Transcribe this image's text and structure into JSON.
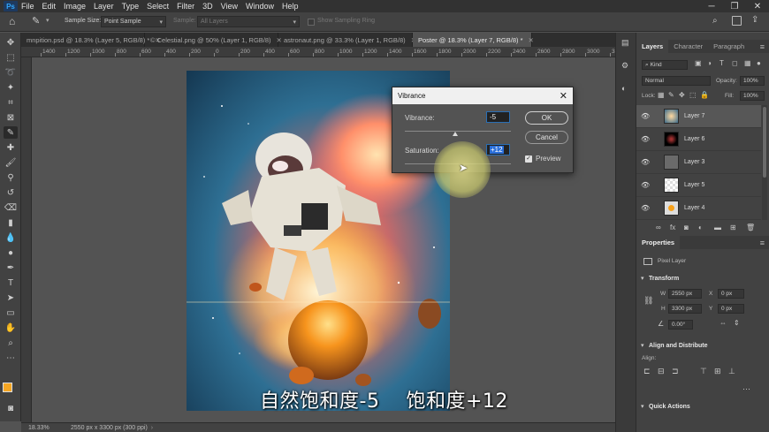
{
  "menubar": {
    "logo": "Ps",
    "items": [
      "File",
      "Edit",
      "Image",
      "Layer",
      "Type",
      "Select",
      "Filter",
      "3D",
      "View",
      "Window",
      "Help"
    ]
  },
  "options": {
    "sample_size_label": "Sample Size:",
    "sample_size_value": "Point Sample",
    "sample_label": "Sample:",
    "sample_value": "All Layers",
    "show_ring_label": "Show Sampling Ring"
  },
  "tabs": [
    {
      "label": "mnpition.psd @ 18.3% (Layer 5, RGB/8) *",
      "active": false
    },
    {
      "label": "© Celestial.png @ 50% (Layer 1, RGB/8)",
      "active": false
    },
    {
      "label": "astronaut.png @ 33.3% (Layer 1, RGB/8)",
      "active": false
    },
    {
      "label": "Poster @ 18.3% (Layer 7, RGB/8) *",
      "active": true
    }
  ],
  "ruler": {
    "ticks": [
      "1400",
      "1200",
      "1000",
      "800",
      "600",
      "400",
      "200",
      "0",
      "200",
      "400",
      "600",
      "800",
      "1000",
      "1200",
      "1400",
      "1600",
      "1800",
      "2000",
      "2200",
      "2400",
      "2600",
      "2800",
      "3000",
      "3200",
      "3400",
      "3600",
      "3800"
    ]
  },
  "status": {
    "zoom": "18.33%",
    "doc_size": "2550 px x 3300 px (300 ppi)"
  },
  "subtitle": {
    "part1": "自然饱和度-5",
    "part2": "饱和度+12"
  },
  "dialog": {
    "title": "Vibrance",
    "vibrance_label": "Vibrance:",
    "vibrance_value": "-5",
    "vibrance_level": -5,
    "saturation_label": "Saturation:",
    "saturation_value": "+12",
    "saturation_level": 12,
    "ok_label": "OK",
    "cancel_label": "Cancel",
    "preview_label": "Preview",
    "preview_checked": true
  },
  "layers_panel": {
    "tabs": [
      "Layers",
      "Character",
      "Paragraph"
    ],
    "filter_kind": "Kind",
    "blend_mode": "Normal",
    "opacity_label": "Opacity:",
    "opacity_value": "100%",
    "lock_label": "Lock:",
    "fill_label": "Fill:",
    "fill_value": "100%",
    "layers": [
      {
        "name": "Layer 7",
        "selected": true
      },
      {
        "name": "Layer 6",
        "selected": false
      },
      {
        "name": "Layer 3",
        "selected": false
      },
      {
        "name": "Layer 5",
        "selected": false
      },
      {
        "name": "Layer 4",
        "selected": false
      }
    ]
  },
  "properties_panel": {
    "tab": "Properties",
    "layer_type": "Pixel Layer",
    "transform_label": "Transform",
    "w_label": "W",
    "w_value": "2550 px",
    "h_label": "H",
    "h_value": "3300 px",
    "x_label": "X",
    "x_value": "0 px",
    "y_label": "Y",
    "y_value": "0 px",
    "angle_value": "0.00°",
    "align_label": "Align and Distribute",
    "align_sub": "Align:",
    "quick_actions_label": "Quick Actions"
  },
  "colors": {
    "foreground": "#f5a623",
    "background": "#111111",
    "accent": "#31a8ff"
  }
}
